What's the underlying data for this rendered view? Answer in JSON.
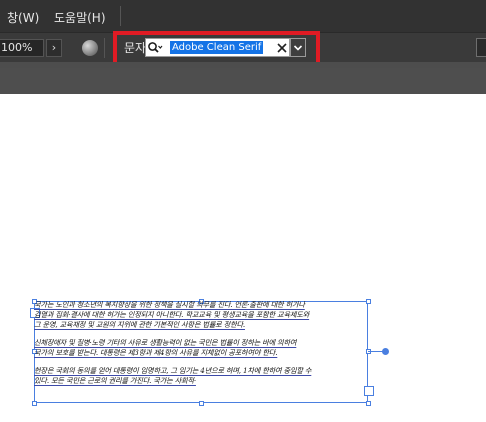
{
  "menubar": {
    "items": [
      {
        "label": "창(W)"
      },
      {
        "label": "도움말(H)"
      }
    ]
  },
  "options_bar": {
    "zoom": "100%",
    "zoom_arrow": "›",
    "char_label": "문자:",
    "font_value": "Adobe Clean Serif"
  },
  "text_frame": {
    "lines": [
      "국가는 노인과 청소년의 복지향상을 위한 정책을 실시할 의무를 진다. 언론·출판에 대한 허가나",
      "검열과 집회·결사에 대한 허가는 인정되지 아니한다. 학교교육 및 평생교육을 포함한 교육제도와",
      "그 운영, 교육재정 및 교원의 지위에 관한 기본적인 사항은 법률로 정한다.",
      "",
      "신체장애자 및 질병·노령 기타의 사유로 생활능력이 없는 국민은 법률이 정하는 바에 의하여",
      "국가의 보호를 받는다. 대통령은 제3항과 제4항의 사유를 지체없이 공포하여야 한다.",
      "",
      "헌장은 국회의 동의를 얻어 대통령이 임명하고, 그 임기는 4년으로 하며, 1차에 한하여 중임할 수",
      "있다. 모든 국민은 근로의 권리를 가진다. 국가는 사회적·"
    ]
  },
  "colors": {
    "highlight": "#e01b24",
    "selection": "#1473e6",
    "frame": "#4a7fe0"
  }
}
